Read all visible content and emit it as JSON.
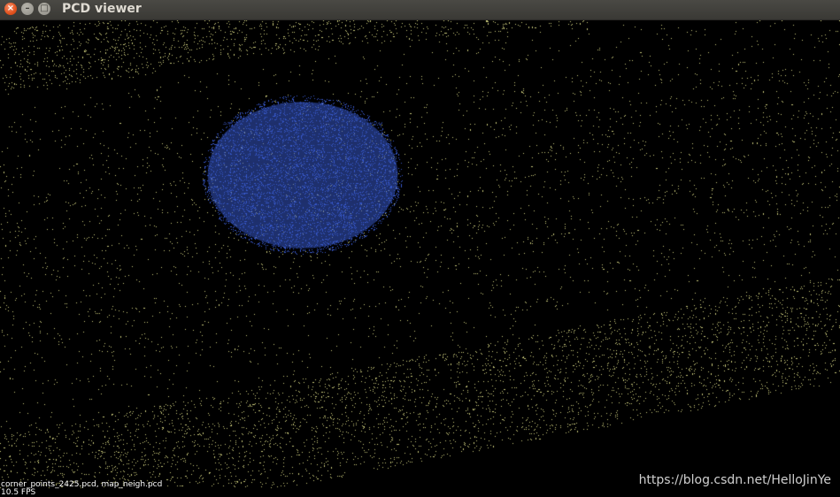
{
  "window": {
    "title": "PCD viewer",
    "close_glyph": "×",
    "minimize_glyph": "–",
    "maximize_glyph": "□"
  },
  "viewer": {
    "loaded_files": "corner_points_2425.pcd, map_neigh.pcd",
    "fps_text": "10.5 FPS",
    "background_color": "#000000",
    "map_points_color": "#c8c87a",
    "highlight_points_color": "#3757c8"
  },
  "watermark": "https://blog.csdn.net/HelloJinYe"
}
